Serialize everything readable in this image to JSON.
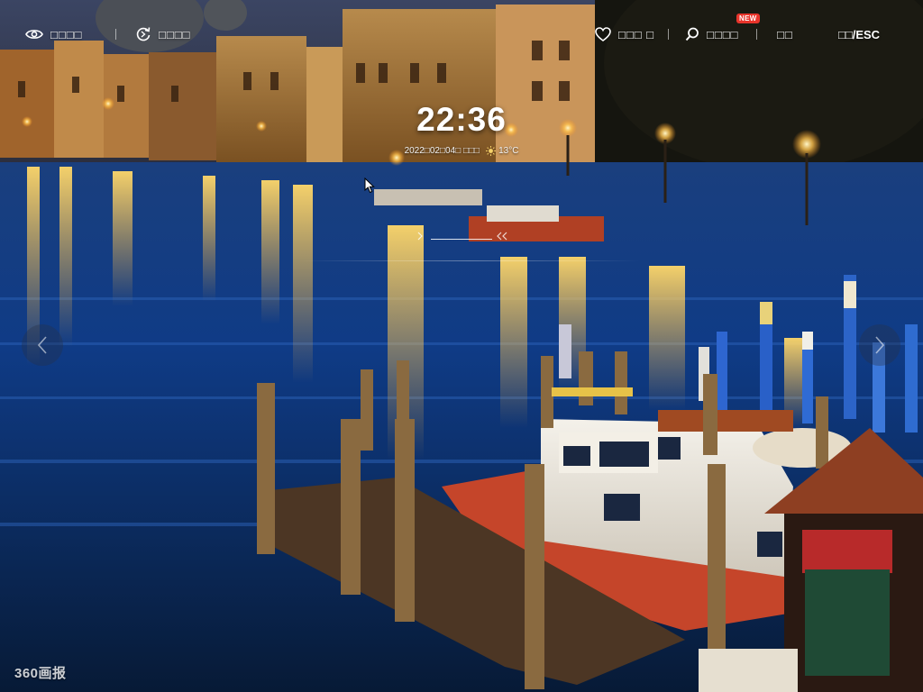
{
  "toolbar": {
    "view_label": "□□□□",
    "refresh_label": "□□□□",
    "favorite_label": "□□□ □",
    "search_label": "□□□□",
    "search_badge": "NEW",
    "more_label": "□□",
    "exit_label": "□□/ESC"
  },
  "clock": {
    "time": "22:36",
    "date": "2022□02□04□ □□□",
    "temperature": "13°C"
  },
  "brand": {
    "logo_text": "360画报"
  },
  "icons": {
    "view": "eye-icon",
    "refresh": "refresh-icon",
    "favorite": "heart-icon",
    "search": "search-icon",
    "weather": "weather-sun-icon",
    "prev": "chevron-left-icon",
    "next": "chevron-right-icon",
    "cursor": "mouse-cursor-icon"
  },
  "colors": {
    "badge": "#e8342b",
    "text": "#ffffff"
  }
}
